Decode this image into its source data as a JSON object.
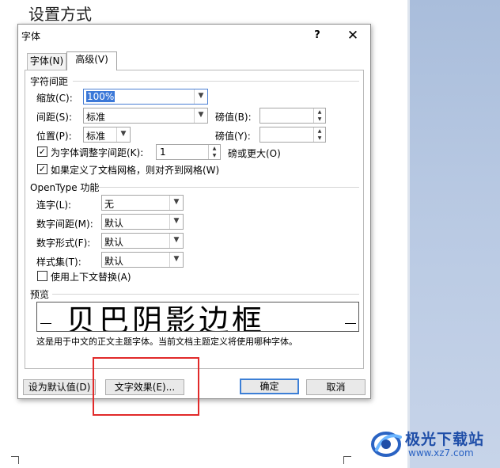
{
  "document": {
    "heading": "设置方式"
  },
  "dialog": {
    "title": "字体",
    "help": "?",
    "close": "✕",
    "tabs": [
      {
        "label": "字体(N)"
      },
      {
        "label": "高级(V)"
      }
    ],
    "spacing": {
      "section": "字符间距",
      "scale_label": "缩放(C):",
      "scale_value": "100%",
      "spacing_label": "间距(S):",
      "spacing_value": "标准",
      "spacing_by_label": "磅值(B):",
      "spacing_by_value": "",
      "position_label": "位置(P):",
      "position_value": "标准",
      "position_by_label": "磅值(Y):",
      "position_by_value": "",
      "kerning_label": "为字体调整字间距(K):",
      "kerning_value": "1",
      "kerning_suffix": "磅或更大(O)",
      "grid_label": "如果定义了文档网格，则对齐到网格(W)"
    },
    "opentype": {
      "section": "OpenType 功能",
      "ligatures_label": "连字(L):",
      "ligatures_value": "无",
      "number_spacing_label": "数字间距(M):",
      "number_spacing_value": "默认",
      "number_forms_label": "数字形式(F):",
      "number_forms_value": "默认",
      "stylistic_sets_label": "样式集(T):",
      "stylistic_sets_value": "默认",
      "contextual_label": "使用上下文替换(A)"
    },
    "preview": {
      "section": "预览",
      "sample": "贝巴阴影边框",
      "description": "这是用于中文的正文主题字体。当前文档主题定义将使用哪种字体。"
    },
    "buttons": {
      "set_default": "设为默认值(D)",
      "text_effects": "文字效果(E)...",
      "ok": "确定",
      "cancel": "取消"
    }
  },
  "watermark": {
    "title": "极光下载站",
    "url": "www.xz7.com"
  },
  "colors": {
    "highlight": "#e12a2a",
    "accent": "#3c7fd6",
    "watermark": "#1f4ea8"
  }
}
